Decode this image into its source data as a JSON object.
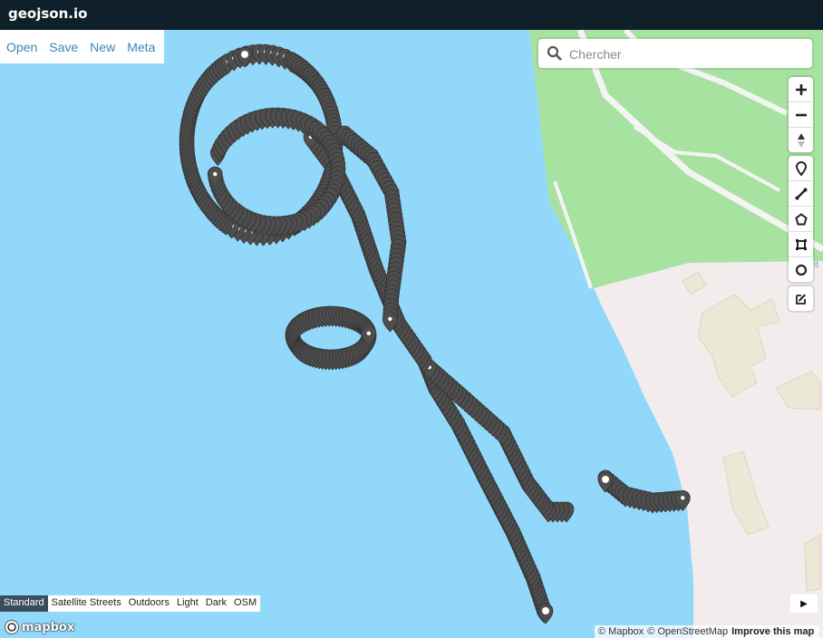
{
  "app": {
    "brand": "geojson.io"
  },
  "file_menu": {
    "items": [
      "Open",
      "Save",
      "New",
      "Meta"
    ]
  },
  "search": {
    "placeholder": "Chercher"
  },
  "map_controls": {
    "zoom": [
      "zoom-in-icon",
      "zoom-out-icon",
      "compass-icon"
    ],
    "draw": [
      "marker-icon",
      "line-icon",
      "polygon-icon",
      "rectangle-icon",
      "circle-icon"
    ],
    "edit": [
      "edit-icon"
    ]
  },
  "map_styles": {
    "items": [
      "Standard",
      "Satellite Streets",
      "Outdoors",
      "Light",
      "Dark",
      "OSM"
    ],
    "active": "Standard"
  },
  "attribution": {
    "mapbox": "© Mapbox",
    "osm": "© OpenStreetMap",
    "improve": "Improve this map"
  },
  "logo": {
    "text": "mapbox"
  },
  "colors": {
    "topbar": "#10202b",
    "water": "#92d8fb",
    "park": "#a8e2a0",
    "land": "#f2ecec",
    "building": "#ece8d6",
    "marker": "#4e4e4e",
    "link": "#3a86b5"
  }
}
